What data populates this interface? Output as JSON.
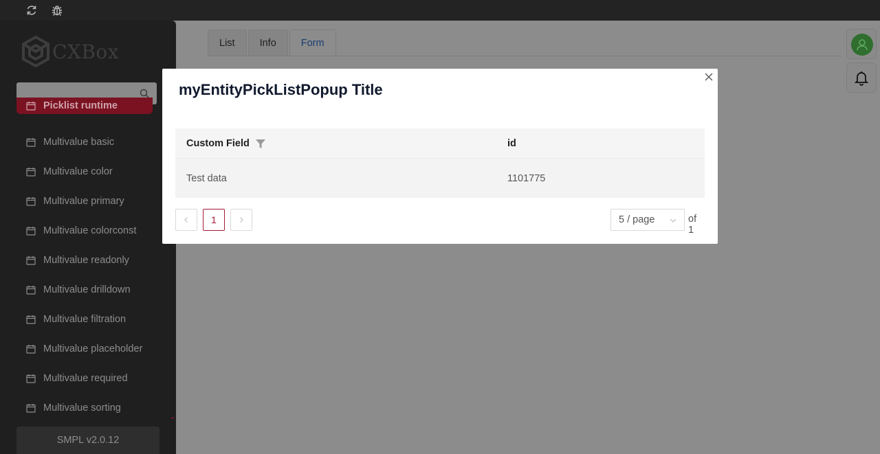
{
  "topbar": {
    "icons": [
      "refresh-icon",
      "bug-icon"
    ]
  },
  "sidebar": {
    "logo_text": "CXBox",
    "search": {
      "placeholder": "",
      "value": ""
    },
    "items": [
      {
        "label": "Picklist runtime",
        "active": true
      },
      {
        "label": "Multivalue basic"
      },
      {
        "label": "Multivalue color"
      },
      {
        "label": "Multivalue primary"
      },
      {
        "label": "Multivalue colorconst"
      },
      {
        "label": "Multivalue readonly"
      },
      {
        "label": "Multivalue drilldown"
      },
      {
        "label": "Multivalue filtration"
      },
      {
        "label": "Multivalue placeholder"
      },
      {
        "label": "Multivalue required"
      },
      {
        "label": "Multivalue sorting"
      }
    ],
    "version": "SMPL v2.0.12"
  },
  "main": {
    "tabs": [
      {
        "label": "List"
      },
      {
        "label": "Info"
      },
      {
        "label": "Form",
        "selected": true
      }
    ]
  },
  "header_icons": [
    "user-icon",
    "bell-icon"
  ],
  "modal": {
    "title": "myEntityPickListPopup Title",
    "columns": [
      {
        "label": "Custom Field",
        "filter": true
      },
      {
        "label": "id"
      }
    ],
    "rows": [
      {
        "custom_field": "Test data",
        "id": "1101775"
      }
    ],
    "pagination": {
      "prev": "<",
      "current_page": "1",
      "next": ">",
      "page_size": "5 / page",
      "total": "of 1"
    }
  },
  "colors": {
    "accent": "#a31a35",
    "active_menu_bg": "#7a1222",
    "avatar_bg": "#2f6e2f"
  }
}
